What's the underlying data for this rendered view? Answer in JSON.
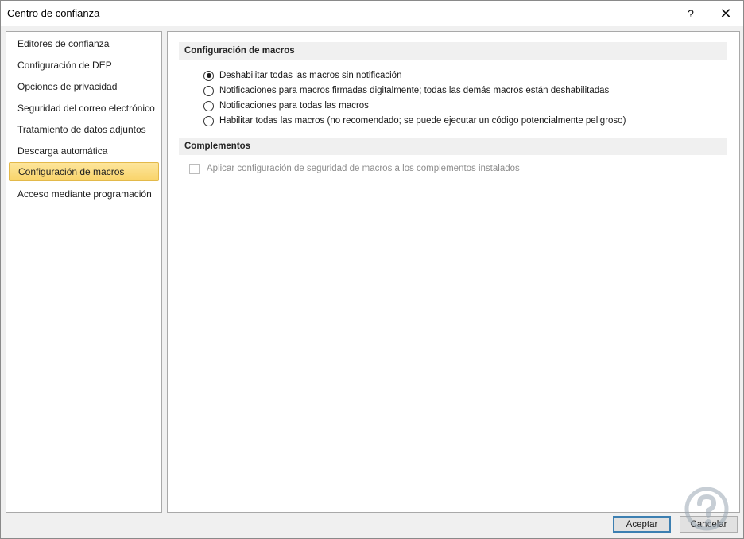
{
  "window": {
    "title": "Centro de confianza",
    "help_glyph": "?",
    "close_glyph": "✕"
  },
  "sidebar": {
    "items": [
      {
        "label": "Editores de confianza",
        "selected": false
      },
      {
        "label": "Configuración de DEP",
        "selected": false
      },
      {
        "label": "Opciones de privacidad",
        "selected": false
      },
      {
        "label": "Seguridad del correo electrónico",
        "selected": false
      },
      {
        "label": "Tratamiento de datos adjuntos",
        "selected": false
      },
      {
        "label": "Descarga automática",
        "selected": false
      },
      {
        "label": "Configuración de macros",
        "selected": true
      },
      {
        "label": "Acceso mediante programación",
        "selected": false
      }
    ],
    "selected_color": "#f9d46a"
  },
  "macros_section": {
    "title": "Configuración de macros",
    "options": [
      {
        "label": "Deshabilitar todas las macros sin notificación",
        "checked": true
      },
      {
        "label": "Notificaciones para macros firmadas digitalmente; todas las demás macros están deshabilitadas",
        "checked": false
      },
      {
        "label": "Notificaciones para todas las macros",
        "checked": false
      },
      {
        "label": "Habilitar todas las macros (no recomendado; se puede ejecutar un código potencialmente peligroso)",
        "checked": false
      }
    ]
  },
  "addins_section": {
    "title": "Complementos",
    "checkbox_label": "Aplicar configuración de seguridad de macros a los complementos instalados",
    "checked": false,
    "enabled": false
  },
  "buttons": {
    "ok_label": "Aceptar",
    "cancel_label": "Cancelar"
  },
  "colors": {
    "accent_border": "#3c7fb1",
    "watermark": "#9aa7b3"
  }
}
